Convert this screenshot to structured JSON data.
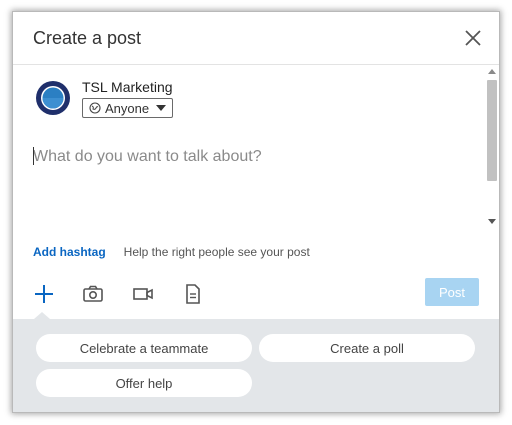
{
  "dialog": {
    "title": "Create a post"
  },
  "author": {
    "name": "TSL Marketing",
    "visibility": "Anyone"
  },
  "composer": {
    "placeholder": "What do you want to talk about?"
  },
  "hashtag": {
    "add_label": "Add hashtag",
    "hint": "Help the right people see your post"
  },
  "toolbar": {
    "icons": [
      "plus-icon",
      "camera-icon",
      "video-icon",
      "document-icon"
    ],
    "post_label": "Post"
  },
  "suggestions": {
    "items": [
      "Celebrate a teammate",
      "Create a poll",
      "Offer help"
    ]
  },
  "colors": {
    "accent": "#0a66c2",
    "post_disabled": "#a8d4f2",
    "panel_bg": "#e3e6e9"
  }
}
